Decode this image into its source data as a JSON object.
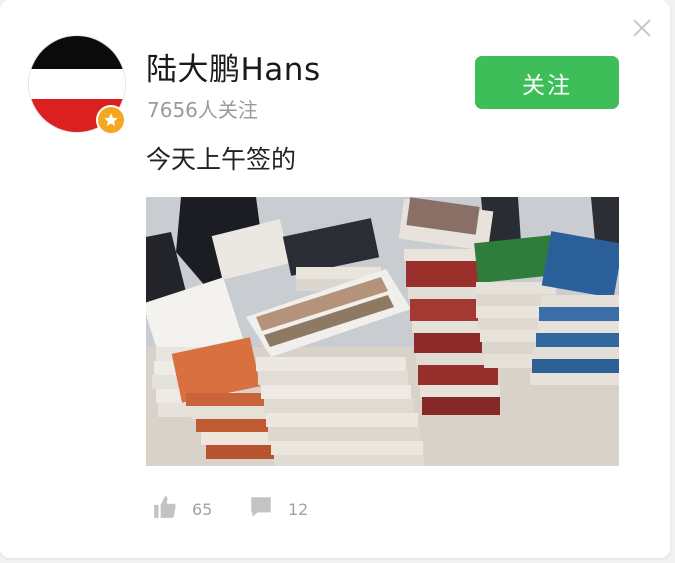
{
  "profile": {
    "name": "陆大鹏Hans",
    "followers": "7656人关注",
    "follow_label": "关注",
    "avatar_colors": [
      "#0b0b0b",
      "#ffffff",
      "#dc1f1f"
    ],
    "badge_icon": "star-icon",
    "badge_color": "#f5a623"
  },
  "post": {
    "text": "今天上午签的",
    "image_description_icon": "book-stacks-photo"
  },
  "actions": {
    "likes": "65",
    "comments": "12",
    "like_icon": "thumbs-up-icon",
    "comment_icon": "comment-icon"
  },
  "colors": {
    "accent": "#3dbe58",
    "muted": "#a3a3a3"
  }
}
